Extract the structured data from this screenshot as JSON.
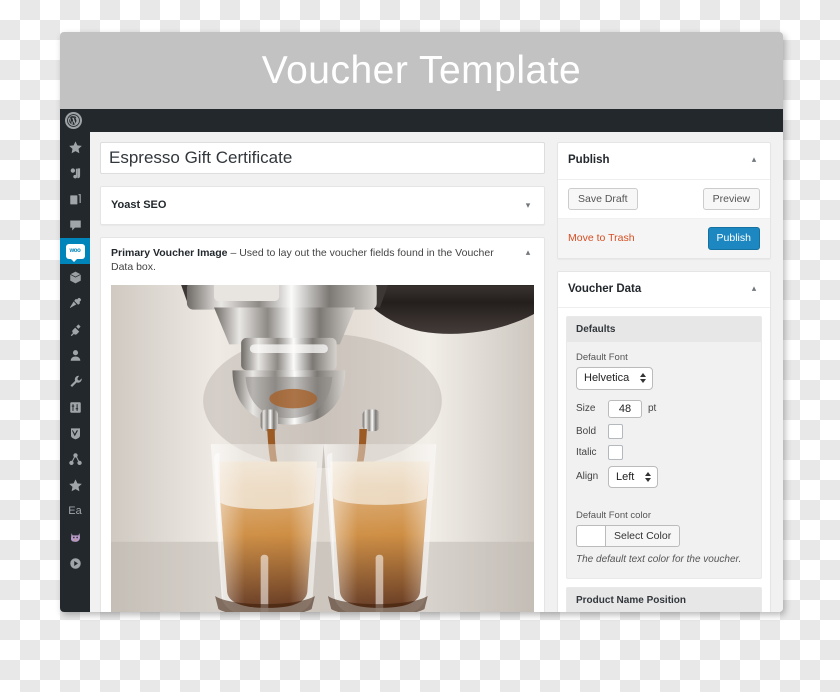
{
  "banner": {
    "title": "Voucher Template",
    "background": "#c2c2c2",
    "text_color": "#ffffff"
  },
  "adminbar": {
    "logo_glyph": "W"
  },
  "sidebar": {
    "accent_color": "#0085ba",
    "background": "#23282d",
    "items": [
      {
        "name": "menu-item-dashboard-star",
        "icon": "star-icon",
        "current": false
      },
      {
        "name": "menu-item-posts",
        "icon": "pin-posts-icon",
        "current": false
      },
      {
        "name": "menu-item-pages",
        "icon": "pages-icon",
        "current": false
      },
      {
        "name": "menu-item-comments",
        "icon": "comment-icon",
        "current": false
      },
      {
        "name": "menu-item-woocommerce",
        "icon": "woocommerce-icon",
        "label": "woo",
        "current": true
      },
      {
        "name": "menu-item-products",
        "icon": "box-icon",
        "current": false
      },
      {
        "name": "menu-item-appearance",
        "icon": "pushpin-icon",
        "current": false
      },
      {
        "name": "menu-item-plugins",
        "icon": "plug-icon",
        "current": false
      },
      {
        "name": "menu-item-users",
        "icon": "user-icon",
        "current": false
      },
      {
        "name": "menu-item-tools",
        "icon": "wrench-icon",
        "current": false
      },
      {
        "name": "menu-item-settings",
        "icon": "sliders-icon",
        "current": false
      },
      {
        "name": "menu-item-yoast",
        "icon": "yoast-icon",
        "current": false
      },
      {
        "name": "menu-item-share",
        "icon": "share-network-icon",
        "current": false
      },
      {
        "name": "menu-item-featured",
        "icon": "star-icon",
        "current": false
      },
      {
        "name": "menu-item-ea",
        "icon": "text-icon",
        "label": "Ea",
        "current": false
      },
      {
        "name": "menu-item-mascot",
        "icon": "cat-icon",
        "current": false
      },
      {
        "name": "menu-item-media-play",
        "icon": "play-circle-icon",
        "current": false
      }
    ]
  },
  "editor": {
    "title_value": "Espresso Gift Certificate",
    "title_placeholder": "Enter title here",
    "yoast_box": {
      "heading": "Yoast SEO",
      "toggle": "▾"
    },
    "image_box": {
      "heading": "Primary Voucher Image",
      "heading_sub": "– Used to lay out the voucher fields found in the Voucher Data box.",
      "toggle": "▴",
      "image_alt": "Espresso machine pouring two shots of espresso into glasses"
    }
  },
  "publish": {
    "heading": "Publish",
    "toggle": "▴",
    "save_draft_label": "Save Draft",
    "preview_label": "Preview",
    "trash_label": "Move to Trash",
    "publish_label": "Publish",
    "publish_color": "#1c87c0",
    "trash_color": "#d54e21"
  },
  "voucher_data": {
    "heading": "Voucher Data",
    "toggle": "▴",
    "defaults": {
      "title": "Defaults",
      "font_label": "Default Font",
      "font_value": "Helvetica",
      "size_label": "Size",
      "size_value": "48",
      "size_unit": "pt",
      "bold_label": "Bold",
      "bold_checked": false,
      "italic_label": "Italic",
      "italic_checked": false,
      "align_label": "Align",
      "align_value": "Left",
      "color_label": "Default Font color",
      "color_button_label": "Select Color",
      "color_swatch": "#ffffff",
      "color_help": "The default text color for the voucher."
    },
    "product_name_position": {
      "title": "Product Name Position"
    }
  }
}
